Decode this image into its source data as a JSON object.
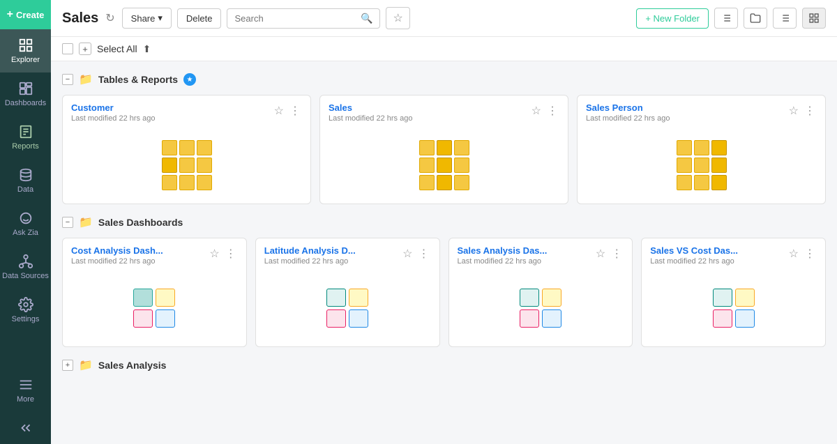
{
  "sidebar": {
    "create_label": "Create",
    "items": [
      {
        "id": "explorer",
        "label": "Explorer",
        "icon": "explorer"
      },
      {
        "id": "dashboards",
        "label": "Dashboards",
        "icon": "dashboards"
      },
      {
        "id": "reports",
        "label": "Reports",
        "icon": "reports",
        "active": true
      },
      {
        "id": "data",
        "label": "Data",
        "icon": "data"
      },
      {
        "id": "ask-zia",
        "label": "Ask Zia",
        "icon": "zia"
      },
      {
        "id": "data-sources",
        "label": "Data Sources",
        "icon": "data-sources"
      },
      {
        "id": "settings",
        "label": "Settings",
        "icon": "settings"
      },
      {
        "id": "more",
        "label": "More",
        "icon": "more"
      }
    ]
  },
  "header": {
    "title": "Sales",
    "share_label": "Share",
    "delete_label": "Delete",
    "search_placeholder": "Search",
    "new_folder_label": "+ New Folder"
  },
  "select_all": {
    "label": "Select All"
  },
  "sections": [
    {
      "id": "tables-reports",
      "title": "Tables & Reports",
      "badge": true,
      "type": "table",
      "cards": [
        {
          "title": "Customer",
          "subtitle": "Last modified 22 hrs ago"
        },
        {
          "title": "Sales",
          "subtitle": "Last modified 22 hrs ago"
        },
        {
          "title": "Sales Person",
          "subtitle": "Last modified 22 hrs ago"
        }
      ]
    },
    {
      "id": "sales-dashboards",
      "title": "Sales Dashboards",
      "badge": false,
      "type": "dashboard",
      "cards": [
        {
          "title": "Cost Analysis Dash...",
          "subtitle": "Last modified 22 hrs ago"
        },
        {
          "title": "Latitude Analysis D...",
          "subtitle": "Last modified 22 hrs ago"
        },
        {
          "title": "Sales Analysis Das...",
          "subtitle": "Last modified 22 hrs ago"
        },
        {
          "title": "Sales VS Cost Das...",
          "subtitle": "Last modified 22 hrs ago"
        }
      ]
    },
    {
      "id": "sales-analysis",
      "title": "Sales Analysis",
      "badge": false,
      "type": "table",
      "cards": []
    }
  ]
}
